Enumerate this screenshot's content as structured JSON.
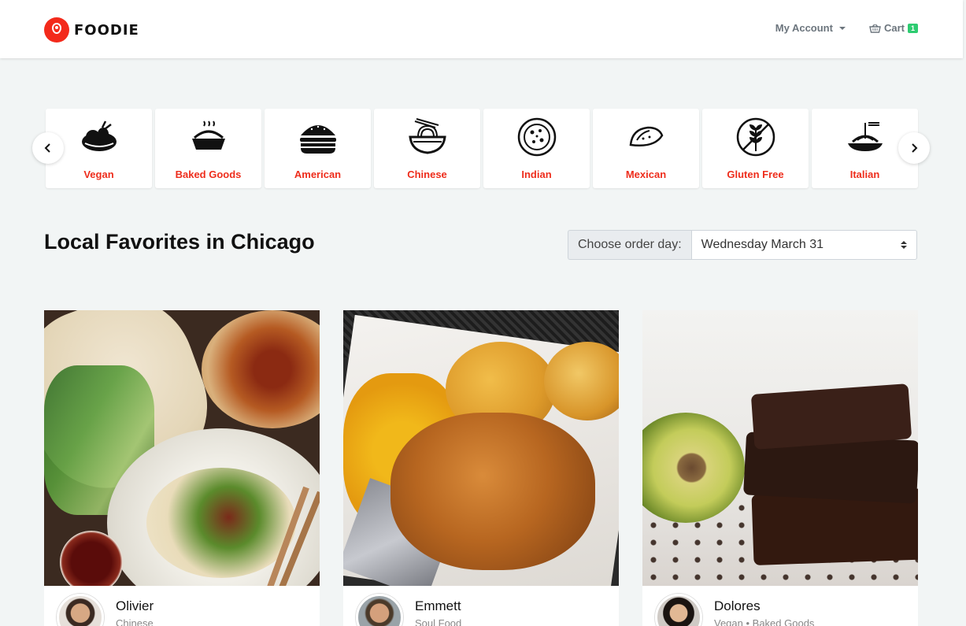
{
  "brand": {
    "name": "FOODIE",
    "accent": "#f32a1b"
  },
  "nav": {
    "account_label": "My Account",
    "cart_label": "Cart",
    "cart_count": "1"
  },
  "categories": [
    {
      "label": "Vegan",
      "icon": "vegan-icon"
    },
    {
      "label": "Baked Goods",
      "icon": "pie-icon"
    },
    {
      "label": "American",
      "icon": "burger-icon"
    },
    {
      "label": "Chinese",
      "icon": "noodle-bowl-icon"
    },
    {
      "label": "Indian",
      "icon": "curry-icon"
    },
    {
      "label": "Mexican",
      "icon": "taco-icon"
    },
    {
      "label": "Gluten Free",
      "icon": "gluten-free-icon"
    },
    {
      "label": "Italian",
      "icon": "pasta-icon"
    }
  ],
  "heading": {
    "bold": "Local Favorites",
    "rest": " in Chicago"
  },
  "order_day": {
    "label": "Choose order day:",
    "selected": "Wednesday March 31"
  },
  "cards": [
    {
      "name": "Olivier",
      "cuisine": "Chinese"
    },
    {
      "name": "Emmett",
      "cuisine": "Soul Food"
    },
    {
      "name": "Dolores",
      "cuisine": "Vegan • Baked Goods"
    }
  ]
}
